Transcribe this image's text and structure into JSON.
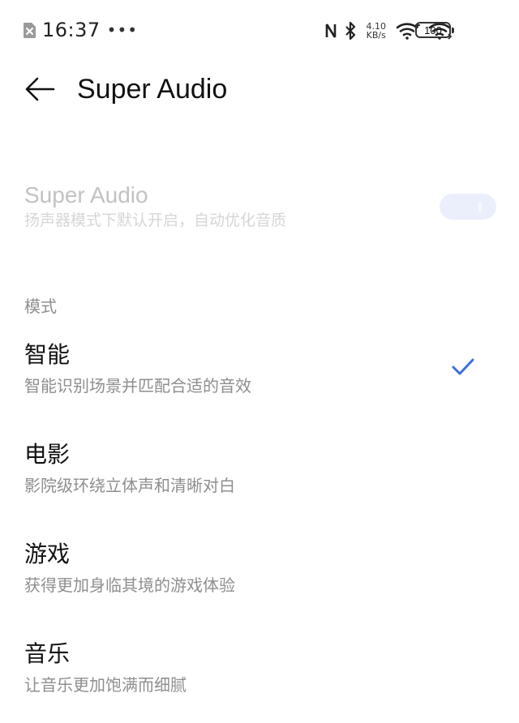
{
  "status_bar": {
    "time": "16:37",
    "more": "•••",
    "net_speed_value": "4.10",
    "net_speed_unit": "KB/s",
    "battery": "100"
  },
  "app_bar": {
    "title": "Super Audio"
  },
  "master": {
    "title": "Super Audio",
    "subtitle": "扬声器模式下默认开启，自动优化音质",
    "toggle_state": "on",
    "enabled": false
  },
  "section": {
    "label": "模式"
  },
  "modes": [
    {
      "title": "智能",
      "description": "智能识别场景并匹配合适的音效",
      "selected": true
    },
    {
      "title": "电影",
      "description": "影院级环绕立体声和清晰对白",
      "selected": false
    },
    {
      "title": "游戏",
      "description": "获得更加身临其境的游戏体验",
      "selected": false
    },
    {
      "title": "音乐",
      "description": "让音乐更加饱满而细腻",
      "selected": false
    }
  ],
  "colors": {
    "accent": "#3b6fd8",
    "disabled_text": "#c2c2c2",
    "secondary_text": "#8e8e8e"
  }
}
